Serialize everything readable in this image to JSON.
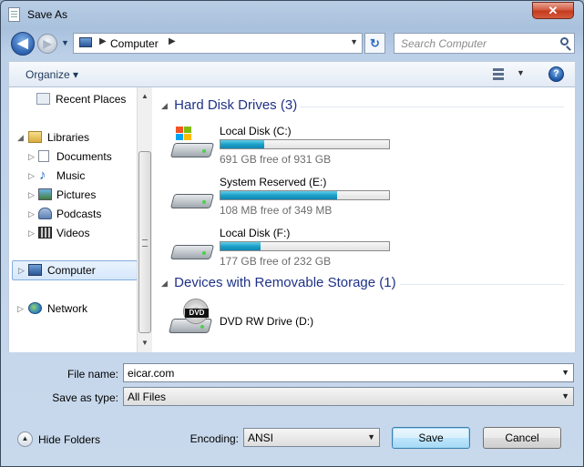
{
  "window": {
    "title": "Save As",
    "close_label": "✕"
  },
  "nav": {
    "back_label": "◀",
    "forward_label": "▶",
    "address": {
      "location": "Computer"
    },
    "search": {
      "placeholder": "Search Computer"
    }
  },
  "toolbar": {
    "organize_label": "Organize ▾"
  },
  "tree": {
    "items": [
      {
        "label": "Recent Places"
      },
      {
        "label": "Libraries"
      },
      {
        "label": "Documents"
      },
      {
        "label": "Music"
      },
      {
        "label": "Pictures"
      },
      {
        "label": "Podcasts"
      },
      {
        "label": "Videos"
      },
      {
        "label": "Computer"
      },
      {
        "label": "Network"
      }
    ]
  },
  "content": {
    "groups": [
      {
        "header": "Hard Disk Drives (3)",
        "drives": [
          {
            "name": "Local Disk (C:)",
            "free_text": "691 GB free of 931 GB",
            "used_fraction": 0.26,
            "icon": "windows-drive-icon"
          },
          {
            "name": "System Reserved (E:)",
            "free_text": "108 MB free of 349 MB",
            "used_fraction": 0.69,
            "icon": "hard-drive-icon"
          },
          {
            "name": "Local Disk (F:)",
            "free_text": "177 GB free of 232 GB",
            "used_fraction": 0.24,
            "icon": "hard-drive-icon"
          }
        ]
      },
      {
        "header": "Devices with Removable Storage (1)",
        "drives": [
          {
            "name": "DVD RW Drive (D:)",
            "icon": "dvd-drive-icon",
            "icon_label": "DVD"
          }
        ]
      }
    ]
  },
  "form": {
    "file_name_label": "File name:",
    "file_name_value": "eicar.com",
    "save_as_type_label": "Save as type:",
    "save_as_type_value": "All Files",
    "encoding_label": "Encoding:",
    "encoding_value": "ANSI"
  },
  "footer": {
    "hide_folders_label": "Hide Folders",
    "save_label": "Save",
    "cancel_label": "Cancel"
  }
}
